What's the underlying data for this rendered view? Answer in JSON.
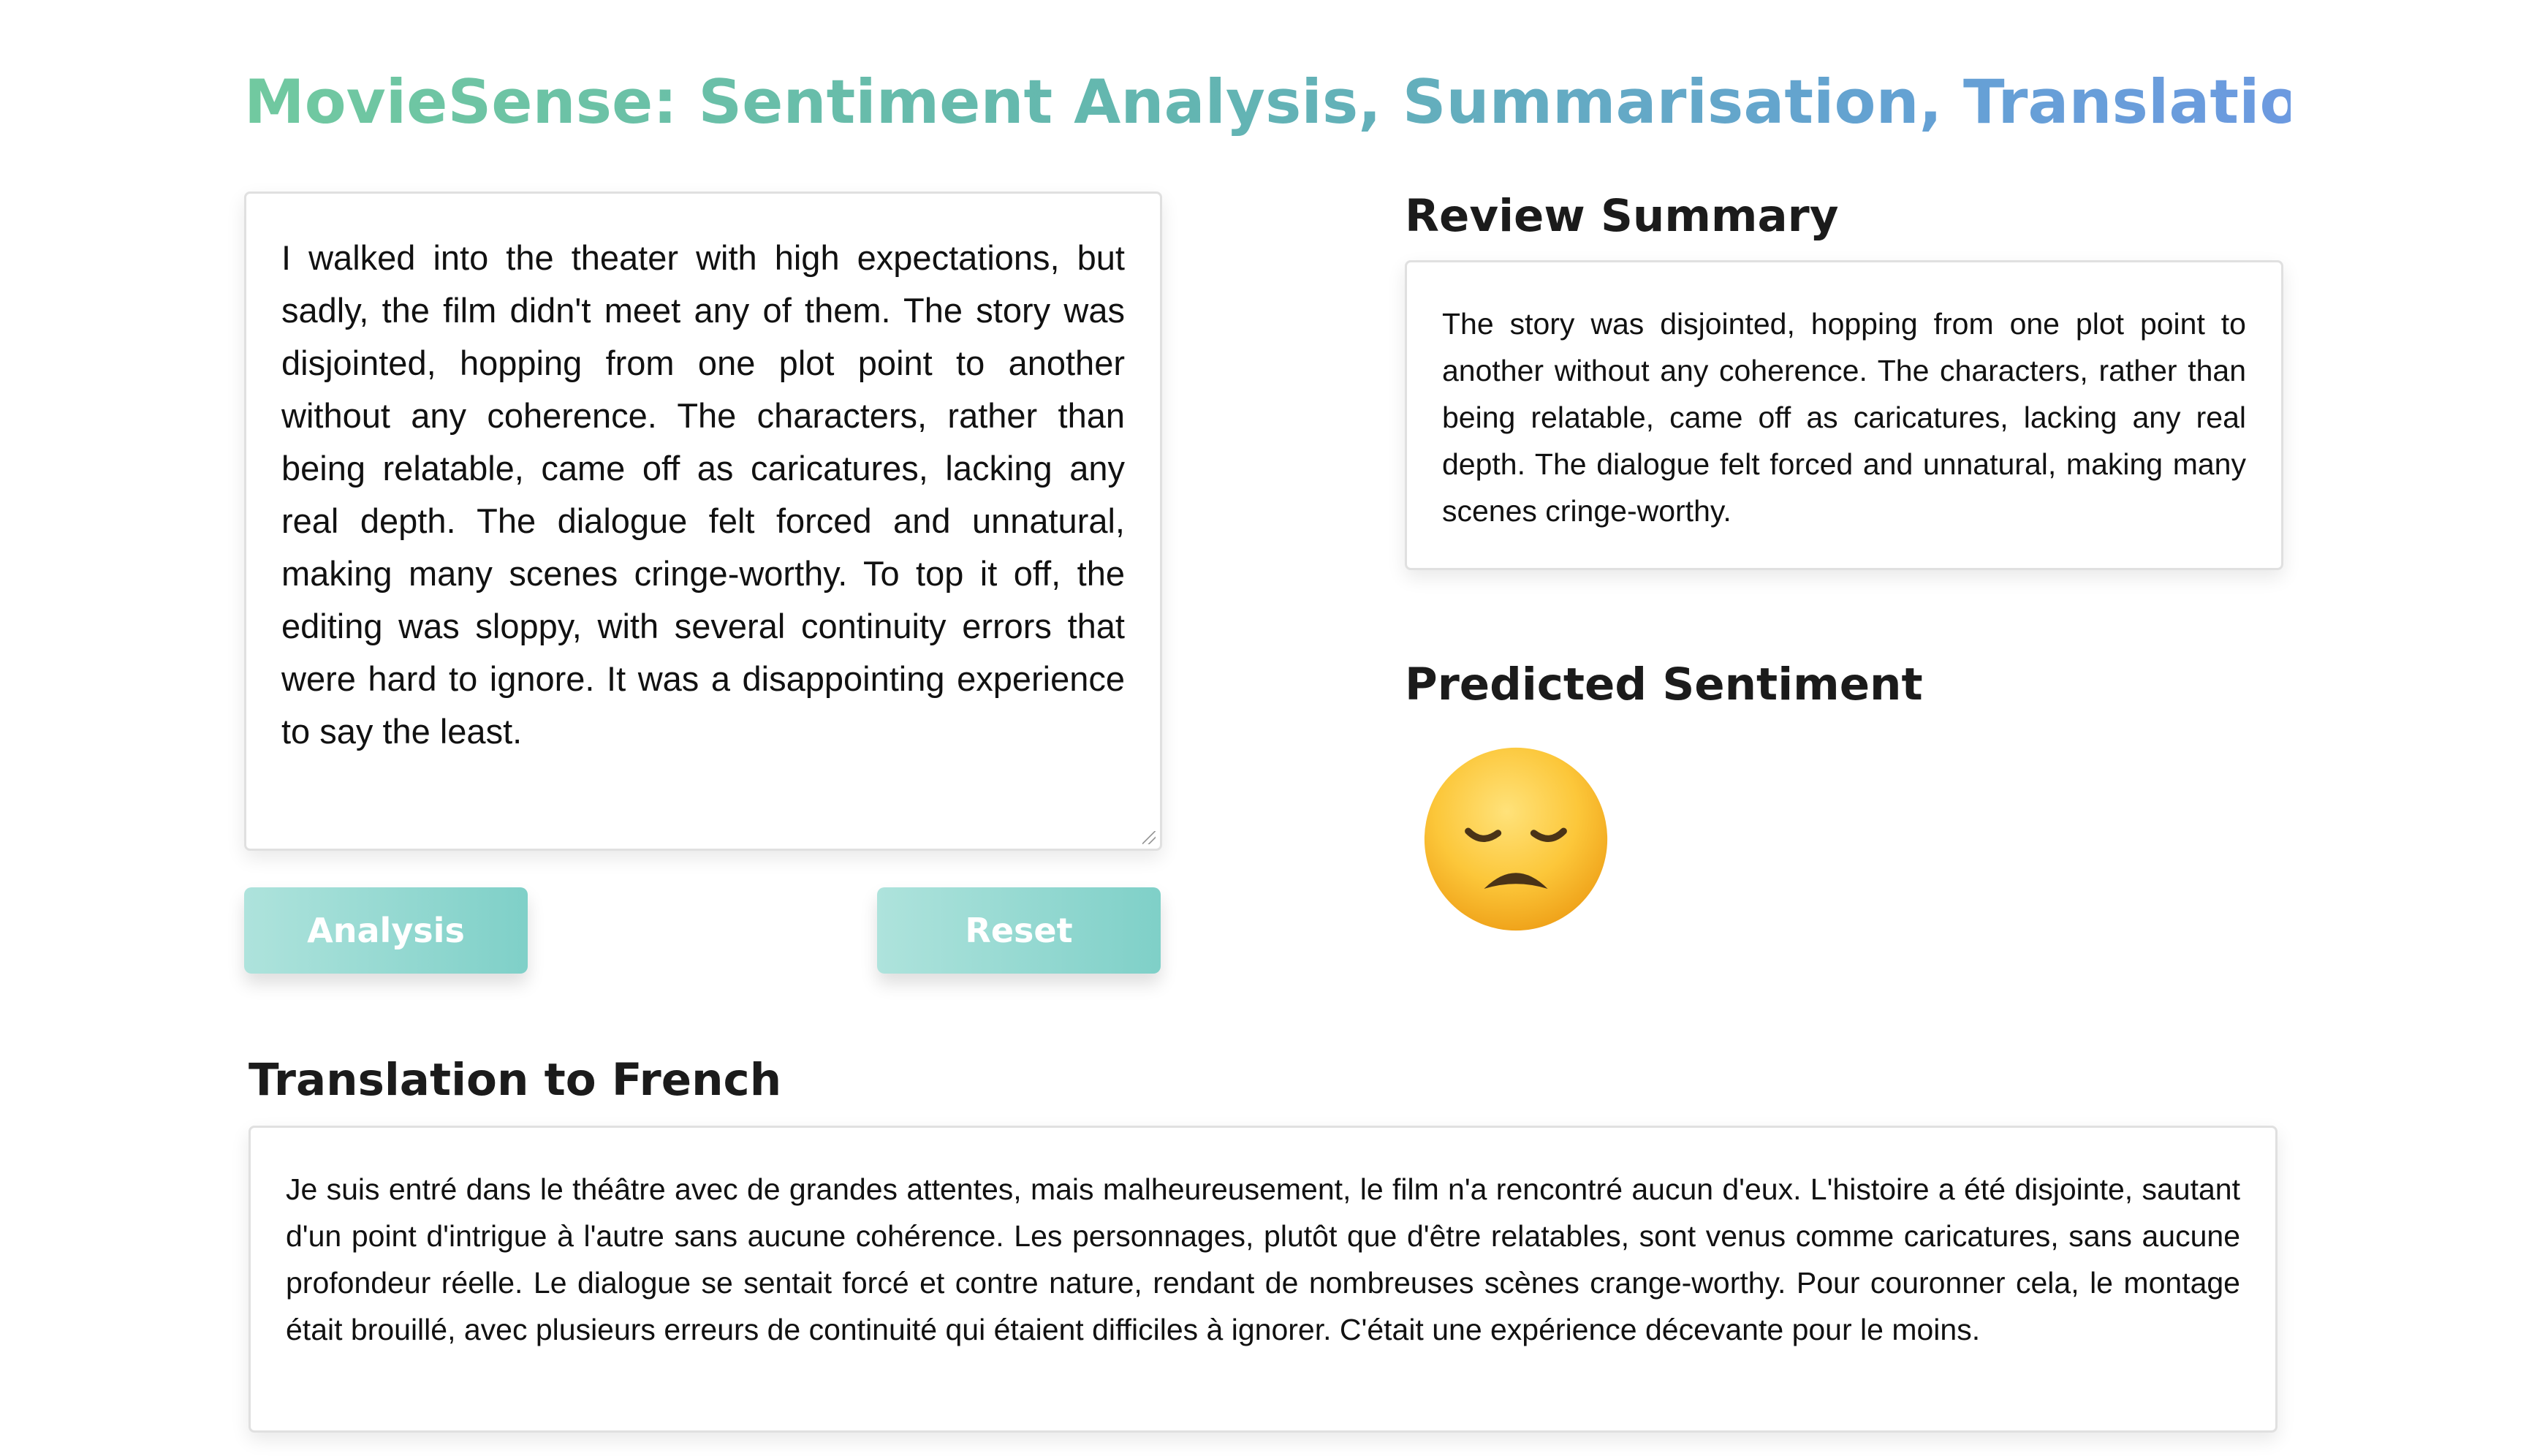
{
  "app": {
    "title": "MovieSense: Sentiment Analysis, Summarisation, Translation"
  },
  "review": {
    "text": "I walked into the theater with high expectations, but sadly, the film didn't meet any of them. The story was disjointed, hopping from one plot point to another without any coherence. The characters, rather than being relatable, came off as caricatures, lacking any real depth. The dialogue felt forced and unnatural, making many scenes cringe-worthy. To top it off, the editing was sloppy, with several continuity errors that were hard to ignore. It was a disappointing experience to say the least."
  },
  "buttons": {
    "analysis_label": "Analysis",
    "reset_label": "Reset"
  },
  "summary": {
    "heading": "Review Summary",
    "text": "The story was disjointed, hopping from one plot point to another without any coherence. The characters, rather than being relatable, came off as caricatures, lacking any real depth. The dialogue felt forced and unnatural, making many scenes cringe-worthy."
  },
  "sentiment": {
    "heading": "Predicted Sentiment",
    "icon": "disappointed-face-icon"
  },
  "translation": {
    "heading": "Translation to French",
    "text": "Je suis entré dans le théâtre avec de grandes attentes, mais malheureusement, le film n'a rencontré aucun d'eux. L'histoire a été disjointe, sautant d'un point d'intrigue à l'autre sans aucune cohérence. Les personnages, plutôt que d'être relatables, sont venus comme caricatures, sans aucune profondeur réelle. Le dialogue se sentait forcé et contre nature, rendant de nombreuses scènes crange-worthy. Pour couronner cela, le montage était brouillé, avec plusieurs erreurs de continuité qui étaient difficiles à ignorer. C'était une expérience décevante pour le moins."
  },
  "colors": {
    "title_gradient_start": "#71c9a0",
    "title_gradient_end": "#6c9ae0",
    "button_gradient_start": "#aee3dc",
    "button_gradient_end": "#7fd0c8"
  }
}
